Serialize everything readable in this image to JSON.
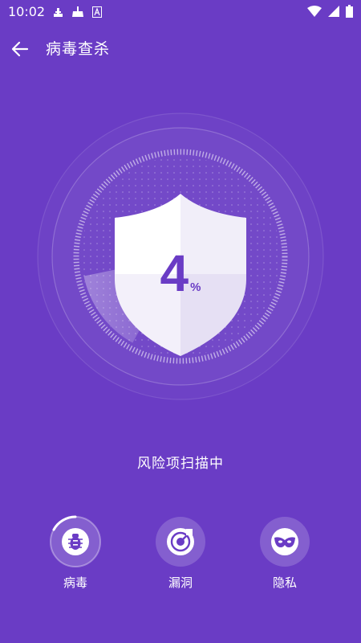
{
  "status_bar": {
    "time": "10:02",
    "left_icons": [
      "notification-icon",
      "cleaner-icon",
      "keyboard-a-icon"
    ],
    "right_icons": [
      "wifi-icon",
      "signal-icon",
      "battery-icon"
    ]
  },
  "header": {
    "title": "病毒查杀"
  },
  "scan": {
    "percent": "4",
    "percent_sign": "%",
    "progress_fraction": 0.04,
    "status_text": "风险项扫描中"
  },
  "categories": [
    {
      "label": "病毒",
      "icon": "bug-icon"
    },
    {
      "label": "漏洞",
      "icon": "radar-icon"
    },
    {
      "label": "隐私",
      "icon": "mask-icon"
    }
  ],
  "colors": {
    "background": "#6a3cc5",
    "shield_light": "#ffffff",
    "shield_shade": "#e4def2",
    "accent_text": "#6a3cc5"
  }
}
